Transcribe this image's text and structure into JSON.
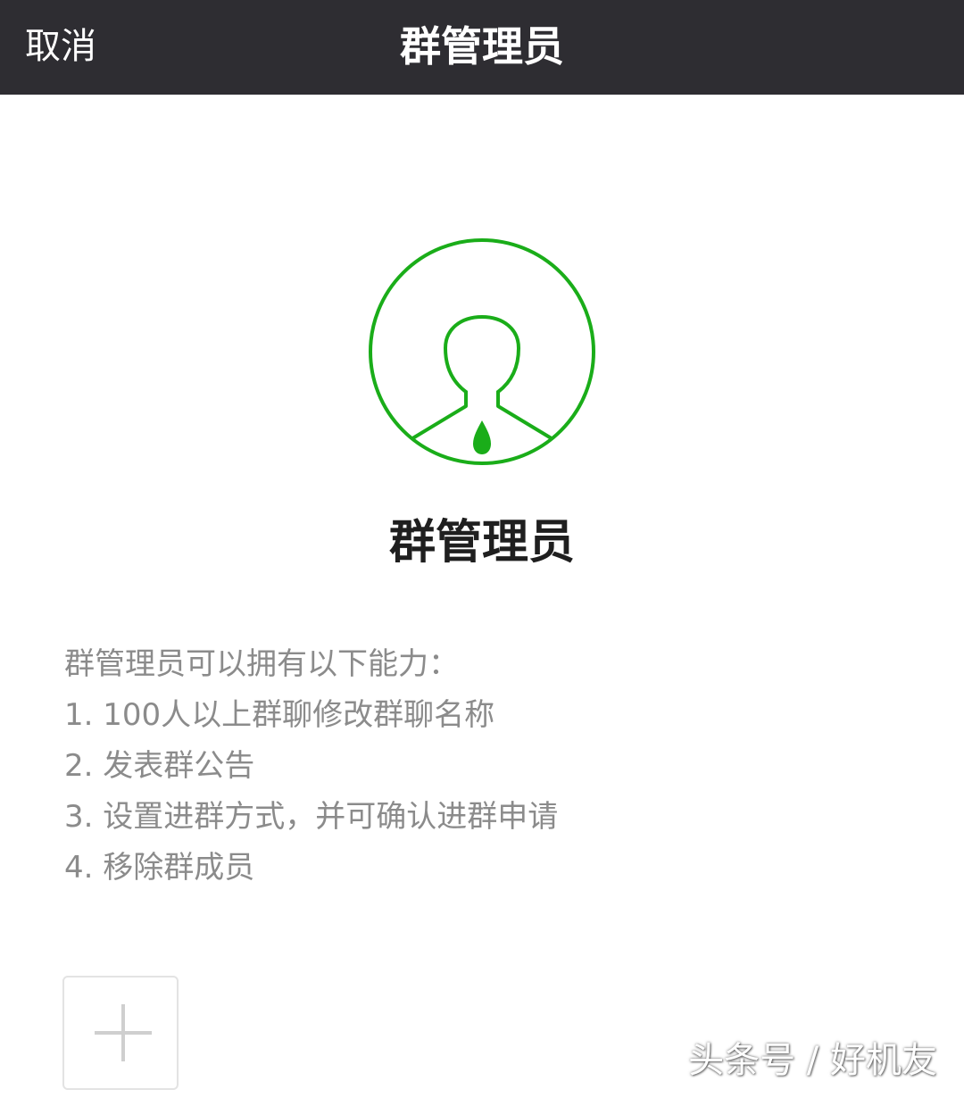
{
  "nav": {
    "cancel_label": "取消",
    "title": "群管理员"
  },
  "hero": {
    "icon": "admin-user-icon",
    "title": "群管理员"
  },
  "description": {
    "intro": "群管理员可以拥有以下能力：",
    "items": [
      "1. 100人以上群聊修改群聊名称",
      "2. 发表群公告",
      "3. 设置进群方式，并可确认进群申请",
      "4. 移除群成员"
    ]
  },
  "add_button": {
    "icon": "plus-icon"
  },
  "watermark": {
    "text": "头条号 / 好机友"
  },
  "colors": {
    "nav_background": "#2e2d32",
    "accent_green": "#1aad19",
    "description_text": "#8b8b8b"
  }
}
